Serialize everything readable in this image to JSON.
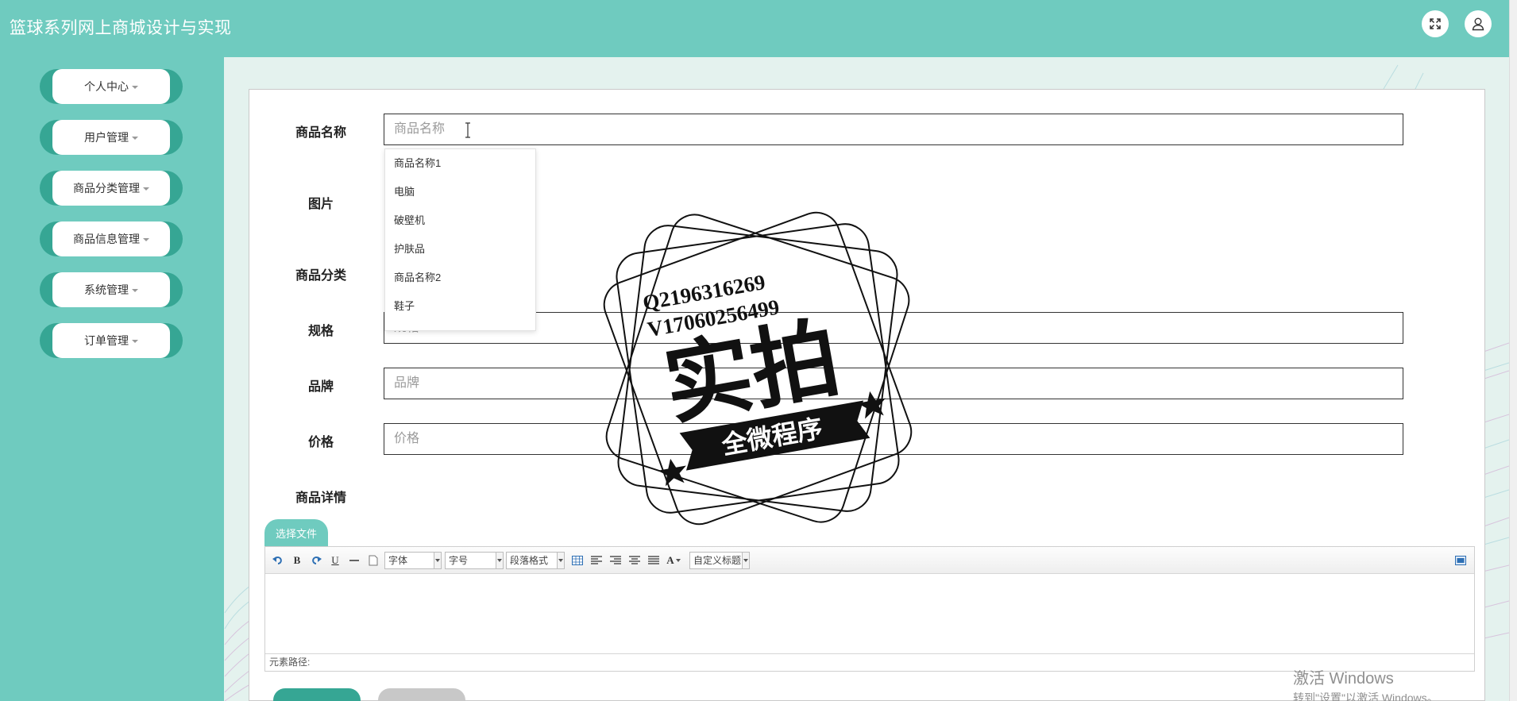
{
  "app": {
    "title": "篮球系列网上商城设计与实现"
  },
  "header": {
    "expand_icon": "expand-icon",
    "user_icon": "user-icon"
  },
  "sidebar": {
    "items": [
      {
        "label": "个人中心"
      },
      {
        "label": "用户管理"
      },
      {
        "label": "商品分类管理"
      },
      {
        "label": "商品信息管理"
      },
      {
        "label": "系统管理"
      },
      {
        "label": "订单管理"
      }
    ]
  },
  "form": {
    "name_label": "商品名称",
    "name_placeholder": "商品名称",
    "image_label": "图片",
    "category_label": "商品分类",
    "spec_label": "规格",
    "spec_placeholder": "规格",
    "brand_label": "品牌",
    "brand_placeholder": "品牌",
    "price_label": "价格",
    "price_placeholder": "价格",
    "detail_label": "商品详情"
  },
  "autocomplete": {
    "options": [
      "商品名称1",
      "电脑",
      "破壁机",
      "护肤品",
      "商品名称2",
      "鞋子"
    ]
  },
  "stamp": {
    "line1": "Q2196316269",
    "line2": "V17060256499",
    "main": "实拍",
    "banner": "全微程序"
  },
  "editor": {
    "upload_label": "选择文件",
    "font_select": "字体",
    "size_select": "字号",
    "paragraph_select": "段落格式",
    "custom_title_select": "自定义标题",
    "bold": "B",
    "underline": "U",
    "font_color": "A",
    "element_path": "元素路径:"
  },
  "watermark": {
    "line1": "激活 Windows",
    "line2": "转到\"设置\"以激活 Windows。"
  },
  "colors": {
    "header_bg": "#6fcbbf",
    "sidebar_bg": "#6fcbbf",
    "menu_accent": "#36a694",
    "main_bg": "#e4f2ee"
  }
}
